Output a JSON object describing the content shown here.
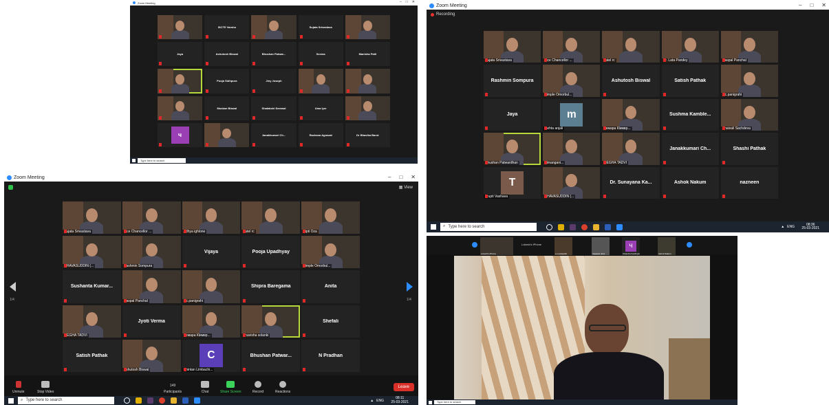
{
  "shot1": {
    "window_title": "Zoom Meeting",
    "rows": [
      [
        {
          "n": "",
          "t": "v"
        },
        {
          "n": "ISCTE Varsha",
          "t": "n"
        },
        {
          "n": "",
          "t": "v"
        },
        {
          "n": "Sujata Srivastava",
          "t": "n"
        },
        {
          "n": "",
          "t": "v"
        }
      ],
      [
        {
          "n": "Jaya",
          "t": "n"
        },
        {
          "n": "Ashutosh Biswal",
          "t": "n"
        },
        {
          "n": "Bhushan Patwar...",
          "t": "n"
        },
        {
          "n": "Seema",
          "t": "n"
        },
        {
          "n": "Manisha Patil",
          "t": "n"
        }
      ],
      [
        {
          "n": "",
          "t": "v",
          "hl": true
        },
        {
          "n": "Pooja Sidhpura",
          "t": "n"
        },
        {
          "n": "Jiny Joseph",
          "t": "n"
        },
        {
          "n": "",
          "t": "v"
        },
        {
          "n": "",
          "t": "v"
        }
      ],
      [
        {
          "n": "",
          "t": "v"
        },
        {
          "n": "Muskan Biswal",
          "t": "n"
        },
        {
          "n": "Shatakshi Semwal",
          "t": "n"
        },
        {
          "n": "Uma Iyer",
          "t": "n"
        },
        {
          "n": "",
          "t": "v"
        }
      ],
      [
        {
          "n": "",
          "t": "a",
          "letter": "ч",
          "color": "#9b3fb5"
        },
        {
          "n": "",
          "t": "v"
        },
        {
          "n": "Janakkumari Ch...",
          "t": "n"
        },
        {
          "n": "Rachana Agrawal",
          "t": "n"
        },
        {
          "n": "Dr Bhavika Barot",
          "t": "n"
        }
      ]
    ]
  },
  "shot2": {
    "window_title": "Zoom Meeting",
    "recording": "Recording",
    "rows": [
      [
        {
          "n": "Sujata Srivastava",
          "t": "v"
        },
        {
          "n": "Vice Chancellor ...",
          "t": "v"
        },
        {
          "n": "patel rc",
          "t": "v"
        },
        {
          "n": "Dr. Lata Pandey",
          "t": "v"
        },
        {
          "n": "Daspal Panchal",
          "t": "v"
        }
      ],
      [
        {
          "n": "Rashmin Sompura",
          "t": "n"
        },
        {
          "n": "Dimple Omorbul...",
          "t": "v"
        },
        {
          "n": "Ashutosh Biswal",
          "t": "n"
        },
        {
          "n": "Satish Pathak",
          "t": "n"
        },
        {
          "n": "s.c.panigrahi",
          "t": "v"
        }
      ],
      [
        {
          "n": "Jaya",
          "t": "n"
        },
        {
          "n": "mehta anjali",
          "t": "a",
          "letter": "m",
          "color": "#5c7f92"
        },
        {
          "n": "Чемара Кlимвр...",
          "t": "v"
        },
        {
          "n": "Sushma  Kamble...",
          "t": "n"
        },
        {
          "n": "Shaivali Sachdeva",
          "t": "v"
        }
      ],
      [
        {
          "n": "Bhushan Patwardhan",
          "t": "v",
          "hl": true
        },
        {
          "n": "Himangani...",
          "t": "v"
        },
        {
          "n": "MEGHA TADVI",
          "t": "v"
        },
        {
          "n": "Janakkumari  Ch...",
          "t": "n"
        },
        {
          "n": "Shashi Pathak",
          "t": "n"
        }
      ],
      [
        {
          "n": "Trupti Vashava",
          "t": "a",
          "letter": "T",
          "color": "#7a5a4a"
        },
        {
          "n": "GHAVASUDDIN (...",
          "t": "v"
        },
        {
          "n": "Dr. Sunayana Ka...",
          "t": "n"
        },
        {
          "n": "Ashok Nakum",
          "t": "n"
        },
        {
          "n": "nazneen",
          "t": "n"
        }
      ]
    ],
    "search": "Type here to search",
    "time": "08:36",
    "date": "25-03-2021",
    "lang": "ENG"
  },
  "shot3": {
    "window_title": "Zoom Meeting",
    "view_label": "View",
    "page_left": "1/4",
    "page_right": "1/4",
    "rows": [
      [
        {
          "n": "Sujata Srivastava",
          "t": "v"
        },
        {
          "n": "Vice Chancellor ...",
          "t": "v"
        },
        {
          "n": "Adhya ighlone",
          "t": "v"
        },
        {
          "n": "patel rc",
          "t": "v"
        },
        {
          "n": "Dipti Oza",
          "t": "v"
        }
      ],
      [
        {
          "n": "GHAVASUDDIN (...",
          "t": "v"
        },
        {
          "n": "Rashmin Sompura",
          "t": "v"
        },
        {
          "n": "Vijaya",
          "t": "n"
        },
        {
          "n": "Pooja Upadhyay",
          "t": "n"
        },
        {
          "n": "Dimple Omorbul...",
          "t": "v"
        }
      ],
      [
        {
          "n": "Sushanta  Kumar...",
          "t": "n"
        },
        {
          "n": "Daspal Panchal",
          "t": "v"
        },
        {
          "n": "s.c.panigrahi",
          "t": "v"
        },
        {
          "n": "Shipra Baregama",
          "t": "n"
        },
        {
          "n": "Anita",
          "t": "n"
        }
      ],
      [
        {
          "n": "MEGHA TADVI",
          "t": "v"
        },
        {
          "n": "Jyoti Verma",
          "t": "n"
        },
        {
          "n": "Чемара Кlимвр...",
          "t": "v"
        },
        {
          "n": "bhavisha solanki",
          "t": "v",
          "hl": true
        },
        {
          "n": "Shefali",
          "t": "n"
        }
      ],
      [
        {
          "n": "Satish Pathak",
          "t": "n"
        },
        {
          "n": "Ashutosh Biswal",
          "t": "v"
        },
        {
          "n": "Chintan Limbachi...",
          "t": "a",
          "letter": "C",
          "color": "#5b3fb8"
        },
        {
          "n": "Bhushan  Patwar...",
          "t": "n"
        },
        {
          "n": "N Pradhan",
          "t": "n"
        }
      ]
    ],
    "controls": {
      "unmute": "Unmute",
      "stop_video": "Stop Video",
      "participants": "Participants",
      "participants_count": "149",
      "chat": "Chat",
      "share_screen": "Share Screen",
      "record": "Record",
      "reactions": "Reactions",
      "leave": "Leave"
    },
    "search": "Type here to search",
    "time": "08:11",
    "date": "25-03-2021",
    "lang": "ENG"
  },
  "shot4": {
    "speaker_label": "Lokesh's iPhone",
    "thumbs": [
      "Lokesh's iPhone",
      "s.c.panigrahi",
      "Yaswant Jinsi",
      "Chandra Kanthiyar",
      "Ashok Nakum"
    ]
  }
}
